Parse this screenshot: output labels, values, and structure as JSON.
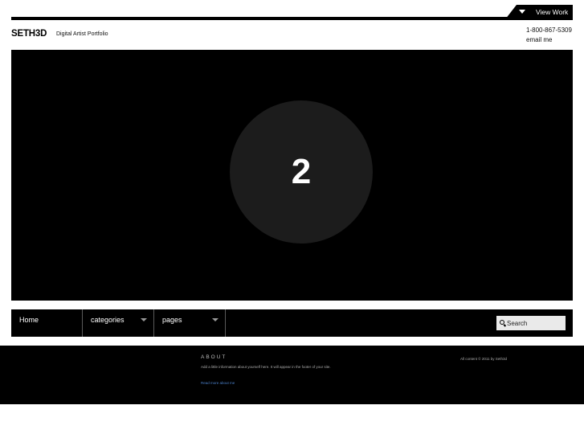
{
  "topbar": {
    "view_work_label": "View Work",
    "arrow_icon": "caret-down-icon"
  },
  "header": {
    "brand": "SETH3D",
    "tagline": "Digital Artist Portfolio",
    "phone": "1-800-867-5309",
    "email_label": "email me"
  },
  "slider": {
    "slide_number": "2"
  },
  "nav": {
    "items": [
      {
        "label": "Home"
      },
      {
        "label": "categories"
      },
      {
        "label": "pages"
      }
    ],
    "search_placeholder": "Search",
    "search_icon": "search-icon"
  },
  "footer": {
    "about_heading": "ABOUT",
    "about_text": "Add a little information about yourself here. It will appear in the footer of your site.",
    "read_more": "Read more about me",
    "copyright": "All content © 2011 by Seth3d"
  },
  "colors": {
    "background": "#ffffff",
    "dark": "#000000",
    "circle": "#1c1c1c",
    "link": "#4a7fc8"
  }
}
